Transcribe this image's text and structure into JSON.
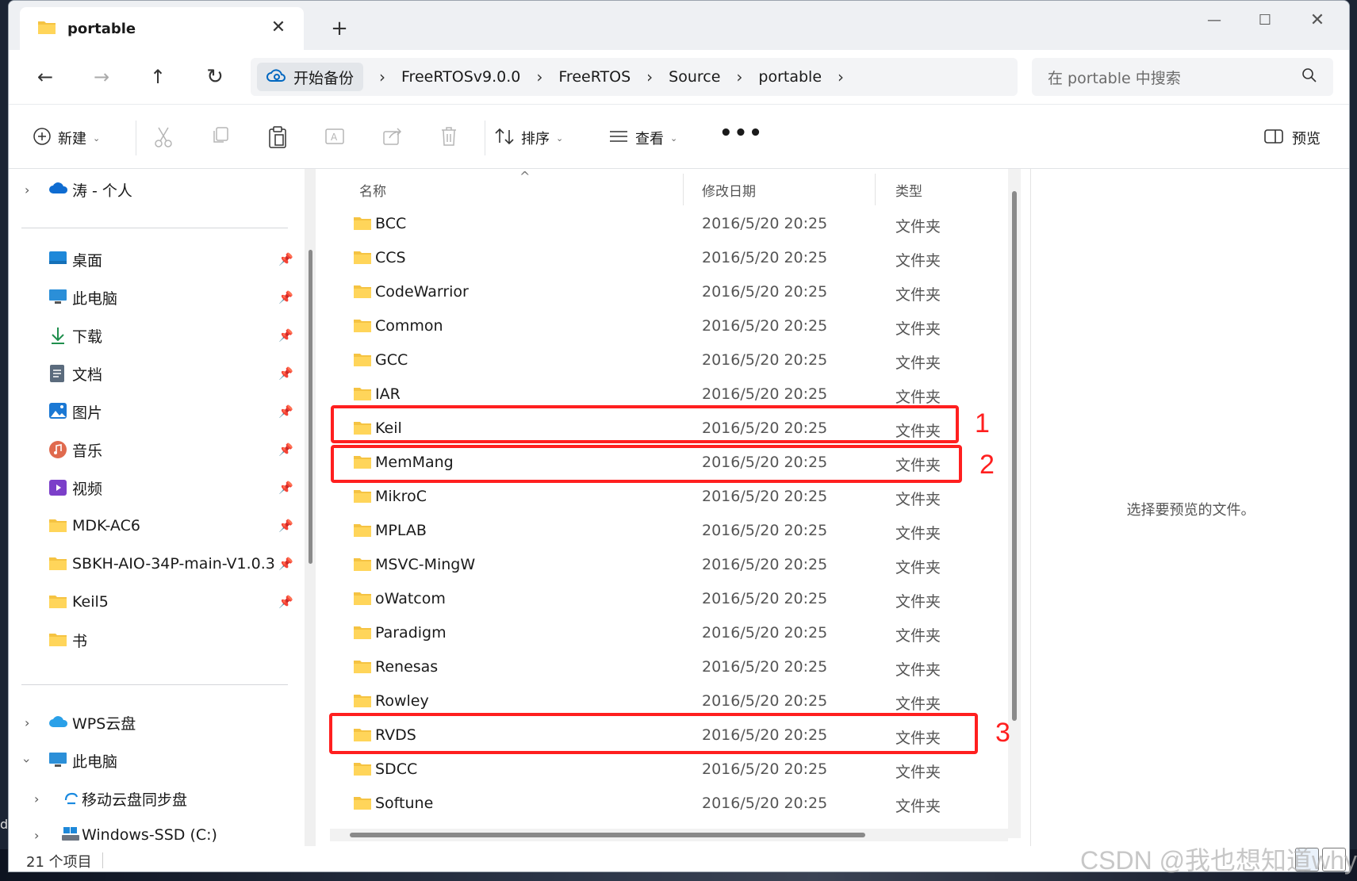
{
  "tab": {
    "title": "portable",
    "close": "✕",
    "new_tab": "+"
  },
  "window_controls": {
    "minimize": "—",
    "maximize": "☐",
    "close": "✕"
  },
  "nav": {
    "back": "←",
    "forward": "→",
    "up": "↑",
    "refresh": "↻"
  },
  "address": {
    "backup_label": "开始备份",
    "separator": "›",
    "crumbs": [
      "FreeRTOSv9.0.0",
      "FreeRTOS",
      "Source",
      "portable"
    ]
  },
  "search": {
    "placeholder": "在 portable 中搜索"
  },
  "commands": {
    "new": "新建",
    "sort": "排序",
    "view": "查看",
    "more": "•••",
    "preview": "预览"
  },
  "sidebar": {
    "onedrive": "涛 - 个人",
    "quick": [
      {
        "label": "桌面",
        "icon": "desktop-icon"
      },
      {
        "label": "此电脑",
        "icon": "computer-icon"
      },
      {
        "label": "下载",
        "icon": "download-icon"
      },
      {
        "label": "文档",
        "icon": "document-icon"
      },
      {
        "label": "图片",
        "icon": "picture-icon"
      },
      {
        "label": "音乐",
        "icon": "music-icon"
      },
      {
        "label": "视频",
        "icon": "video-icon"
      },
      {
        "label": "MDK-AC6",
        "icon": "folder-icon"
      },
      {
        "label": "SBKH-AIO-34P-main-V1.0.3",
        "icon": "folder-icon"
      },
      {
        "label": "Keil5",
        "icon": "folder-icon"
      },
      {
        "label": "书",
        "icon": "folder-icon"
      }
    ],
    "wps": "WPS云盘",
    "this_pc": "此电脑",
    "cloud_sync": "移动云盘同步盘",
    "drive_c": "Windows-SSD (C:)"
  },
  "list": {
    "headers": {
      "name": "名称",
      "modified": "修改日期",
      "type": "类型"
    },
    "sort_indicator": "^",
    "rows": [
      {
        "name": "BCC",
        "date": "2016/5/20 20:25",
        "type": "文件夹"
      },
      {
        "name": "CCS",
        "date": "2016/5/20 20:25",
        "type": "文件夹"
      },
      {
        "name": "CodeWarrior",
        "date": "2016/5/20 20:25",
        "type": "文件夹"
      },
      {
        "name": "Common",
        "date": "2016/5/20 20:25",
        "type": "文件夹"
      },
      {
        "name": "GCC",
        "date": "2016/5/20 20:25",
        "type": "文件夹"
      },
      {
        "name": "IAR",
        "date": "2016/5/20 20:25",
        "type": "文件夹"
      },
      {
        "name": "Keil",
        "date": "2016/5/20 20:25",
        "type": "文件夹"
      },
      {
        "name": "MemMang",
        "date": "2016/5/20 20:25",
        "type": "文件夹"
      },
      {
        "name": "MikroC",
        "date": "2016/5/20 20:25",
        "type": "文件夹"
      },
      {
        "name": "MPLAB",
        "date": "2016/5/20 20:25",
        "type": "文件夹"
      },
      {
        "name": "MSVC-MingW",
        "date": "2016/5/20 20:25",
        "type": "文件夹"
      },
      {
        "name": "oWatcom",
        "date": "2016/5/20 20:25",
        "type": "文件夹"
      },
      {
        "name": "Paradigm",
        "date": "2016/5/20 20:25",
        "type": "文件夹"
      },
      {
        "name": "Renesas",
        "date": "2016/5/20 20:25",
        "type": "文件夹"
      },
      {
        "name": "Rowley",
        "date": "2016/5/20 20:25",
        "type": "文件夹"
      },
      {
        "name": "RVDS",
        "date": "2016/5/20 20:25",
        "type": "文件夹"
      },
      {
        "name": "SDCC",
        "date": "2016/5/20 20:25",
        "type": "文件夹"
      },
      {
        "name": "Softune",
        "date": "2016/5/20 20:25",
        "type": "文件夹"
      }
    ]
  },
  "annotations": [
    {
      "label": "1",
      "row": "Keil"
    },
    {
      "label": "2",
      "row": "MemMang"
    },
    {
      "label": "3",
      "row": "RVDS"
    }
  ],
  "preview": {
    "empty_text": "选择要预览的文件。"
  },
  "status": {
    "count": "21 个项目"
  },
  "watermark": "CSDN @我也想知道why",
  "colors": {
    "accent": "#0067c0",
    "annotation": "#ff1f1f",
    "folder": "#f5c342"
  }
}
